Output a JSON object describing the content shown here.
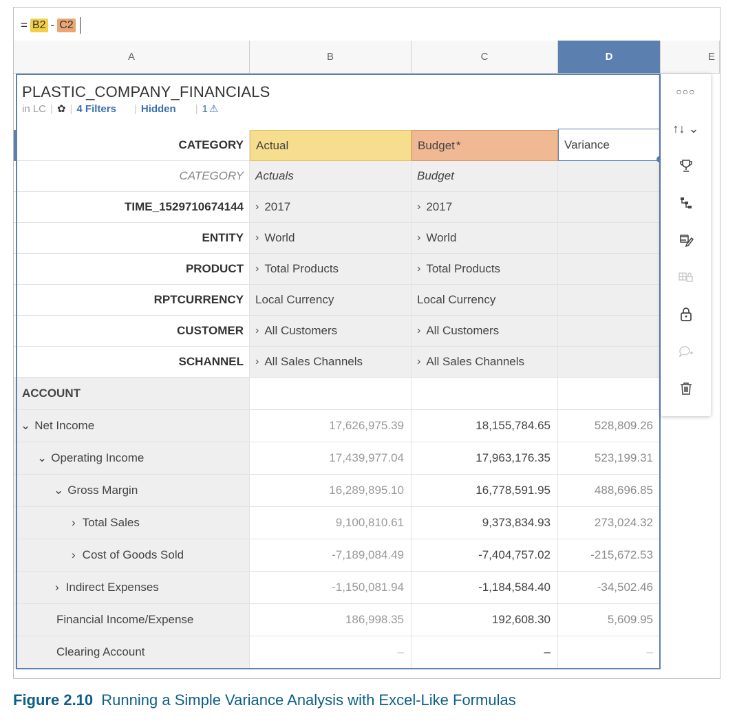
{
  "formula": {
    "equals": "=",
    "ref1": "B2",
    "op": "-",
    "ref2": "C2"
  },
  "columns": [
    "A",
    "B",
    "C",
    "D",
    "E"
  ],
  "table": {
    "title": "PLASTIC_COMPANY_FINANCIALS",
    "source": "in LC",
    "filters": "4 Filters",
    "hidden": "Hidden",
    "warnings": "1"
  },
  "header_rows": [
    {
      "label": "CATEGORY",
      "b": "Actual",
      "c": "Budget",
      "c_mark": "*",
      "d": "Variance"
    },
    {
      "label": "CATEGORY",
      "b": "Actuals",
      "c": "Budget"
    },
    {
      "label": "TIME_1529710674144",
      "b": "2017",
      "c": "2017"
    },
    {
      "label": "ENTITY",
      "b": "World",
      "c": "World"
    },
    {
      "label": "PRODUCT",
      "b": "Total Products",
      "c": "Total Products"
    },
    {
      "label": "RPTCURRENCY",
      "b": "Local Currency",
      "c": "Local Currency"
    },
    {
      "label": "CUSTOMER",
      "b": "All Customers",
      "c": "All Customers"
    },
    {
      "label": "SCHANNEL",
      "b": "All Sales Channels",
      "c": "All Sales Channels"
    }
  ],
  "account_label": "ACCOUNT",
  "rows": [
    {
      "name": "Net Income",
      "actual": "17,626,975.39",
      "budget": "18,155,784.65",
      "variance": "528,809.26"
    },
    {
      "name": "Operating Income",
      "actual": "17,439,977.04",
      "budget": "17,963,176.35",
      "variance": "523,199.31"
    },
    {
      "name": "Gross Margin",
      "actual": "16,289,895.10",
      "budget": "16,778,591.95",
      "variance": "488,696.85"
    },
    {
      "name": "Total Sales",
      "actual": "9,100,810.61",
      "budget": "9,373,834.93",
      "variance": "273,024.32"
    },
    {
      "name": "Cost of Goods Sold",
      "actual": "-7,189,084.49",
      "budget": "-7,404,757.02",
      "variance": "-215,672.53"
    },
    {
      "name": "Indirect Expenses",
      "actual": "-1,150,081.94",
      "budget": "-1,184,584.40",
      "variance": "-34,502.46"
    },
    {
      "name": "Financial Income/Expense",
      "actual": "186,998.35",
      "budget": "192,608.30",
      "variance": "5,609.95"
    },
    {
      "name": "Clearing Account",
      "actual": "–",
      "budget": "–",
      "variance": "–"
    }
  ],
  "toolbar_icons": [
    "more-icon",
    "sort-icon",
    "trophy-icon",
    "hierarchy-icon",
    "edit-formula-icon",
    "lock-cells-icon",
    "lock-icon",
    "add-comment-icon",
    "delete-icon"
  ],
  "caption": {
    "label": "Figure 2.10",
    "text": "Running a Simple Variance Analysis with Excel-Like Formulas"
  },
  "colors": {
    "accent": "#5b7fae",
    "actual_header": "#f6de8e",
    "budget_header": "#f0b994",
    "caption": "#0d5f86"
  }
}
